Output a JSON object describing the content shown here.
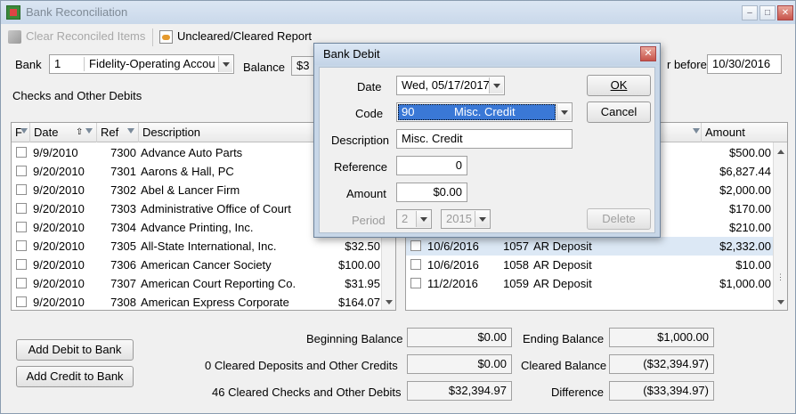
{
  "window": {
    "title": "Bank Reconciliation"
  },
  "toolbar": {
    "clear_label": "Clear Reconciled Items",
    "report_label": "Uncleared/Cleared Report"
  },
  "bank": {
    "label": "Bank",
    "number": "1",
    "name": "Fidelity-Operating Accou",
    "balance_label": "Balance",
    "balance_partial": "$3",
    "before_label": "r before",
    "before_date": "10/30/2016"
  },
  "checks": {
    "section_label": "Checks and Other Debits",
    "headers": {
      "flag": "F",
      "date": "Date",
      "ref": "Ref",
      "desc": "Description"
    },
    "rows": [
      {
        "date": "9/9/2010",
        "ref": "7300",
        "desc": "Advance Auto Parts",
        "amount": ""
      },
      {
        "date": "9/20/2010",
        "ref": "7301",
        "desc": "Aarons & Hall, PC",
        "amount": ""
      },
      {
        "date": "9/20/2010",
        "ref": "7302",
        "desc": "Abel & Lancer Firm",
        "amount": ""
      },
      {
        "date": "9/20/2010",
        "ref": "7303",
        "desc": "Administrative Office of Court",
        "amount": ""
      },
      {
        "date": "9/20/2010",
        "ref": "7304",
        "desc": "Advance Printing, Inc.",
        "amount": ""
      },
      {
        "date": "9/20/2010",
        "ref": "7305",
        "desc": "All-State International, Inc.",
        "amount": "$32.50"
      },
      {
        "date": "9/20/2010",
        "ref": "7306",
        "desc": "American Cancer Society",
        "amount": "$100.00"
      },
      {
        "date": "9/20/2010",
        "ref": "7307",
        "desc": "American Court Reporting Co.",
        "amount": "$31.95"
      },
      {
        "date": "9/20/2010",
        "ref": "7308",
        "desc": "American Express Corporate",
        "amount": "$164.07"
      }
    ]
  },
  "deposits": {
    "headers": {
      "amount": "Amount"
    },
    "rows": [
      {
        "date": "",
        "ref": "",
        "desc": "",
        "amount": "$500.00"
      },
      {
        "date": "",
        "ref": "",
        "desc": "",
        "amount": "$6,827.44"
      },
      {
        "date": "",
        "ref": "",
        "desc": "",
        "amount": "$2,000.00"
      },
      {
        "date": "",
        "ref": "",
        "desc": "",
        "amount": "$170.00"
      },
      {
        "date": "",
        "ref": "",
        "desc": "",
        "amount": "$210.00"
      },
      {
        "date": "10/6/2016",
        "ref": "1057",
        "desc": "AR Deposit",
        "amount": "$2,332.00"
      },
      {
        "date": "10/6/2016",
        "ref": "1058",
        "desc": "AR Deposit",
        "amount": "$10.00"
      },
      {
        "date": "11/2/2016",
        "ref": "1059",
        "desc": "AR Deposit",
        "amount": "$1,000.00"
      }
    ]
  },
  "buttons": {
    "add_debit": "Add Debit to Bank",
    "add_credit": "Add Credit to Bank"
  },
  "summary": {
    "beginning_label": "Beginning Balance",
    "beginning_value": "$0.00",
    "cleared_deposits_label": "0 Cleared Deposits and Other Credits",
    "cleared_deposits_value": "$0.00",
    "cleared_checks_label": "46 Cleared Checks and Other Debits",
    "cleared_checks_value": "$32,394.97",
    "ending_label": "Ending Balance",
    "ending_value": "$1,000.00",
    "cleared_balance_label": "Cleared Balance",
    "cleared_balance_value": "($32,394.97)",
    "difference_label": "Difference",
    "difference_value": "($33,394.97)"
  },
  "dialog": {
    "title": "Bank Debit",
    "date_label": "Date",
    "date_value": "Wed, 05/17/2017",
    "code_label": "Code",
    "code_num": "90",
    "code_name": "Misc. Credit",
    "desc_label": "Description",
    "desc_value": "Misc. Credit",
    "ref_label": "Reference",
    "ref_value": "0",
    "amount_label": "Amount",
    "amount_value": "$0.00",
    "period_label": "Period",
    "period_value": "2",
    "year_value": "2015",
    "ok_label": "OK",
    "cancel_label": "Cancel",
    "delete_label": "Delete"
  }
}
